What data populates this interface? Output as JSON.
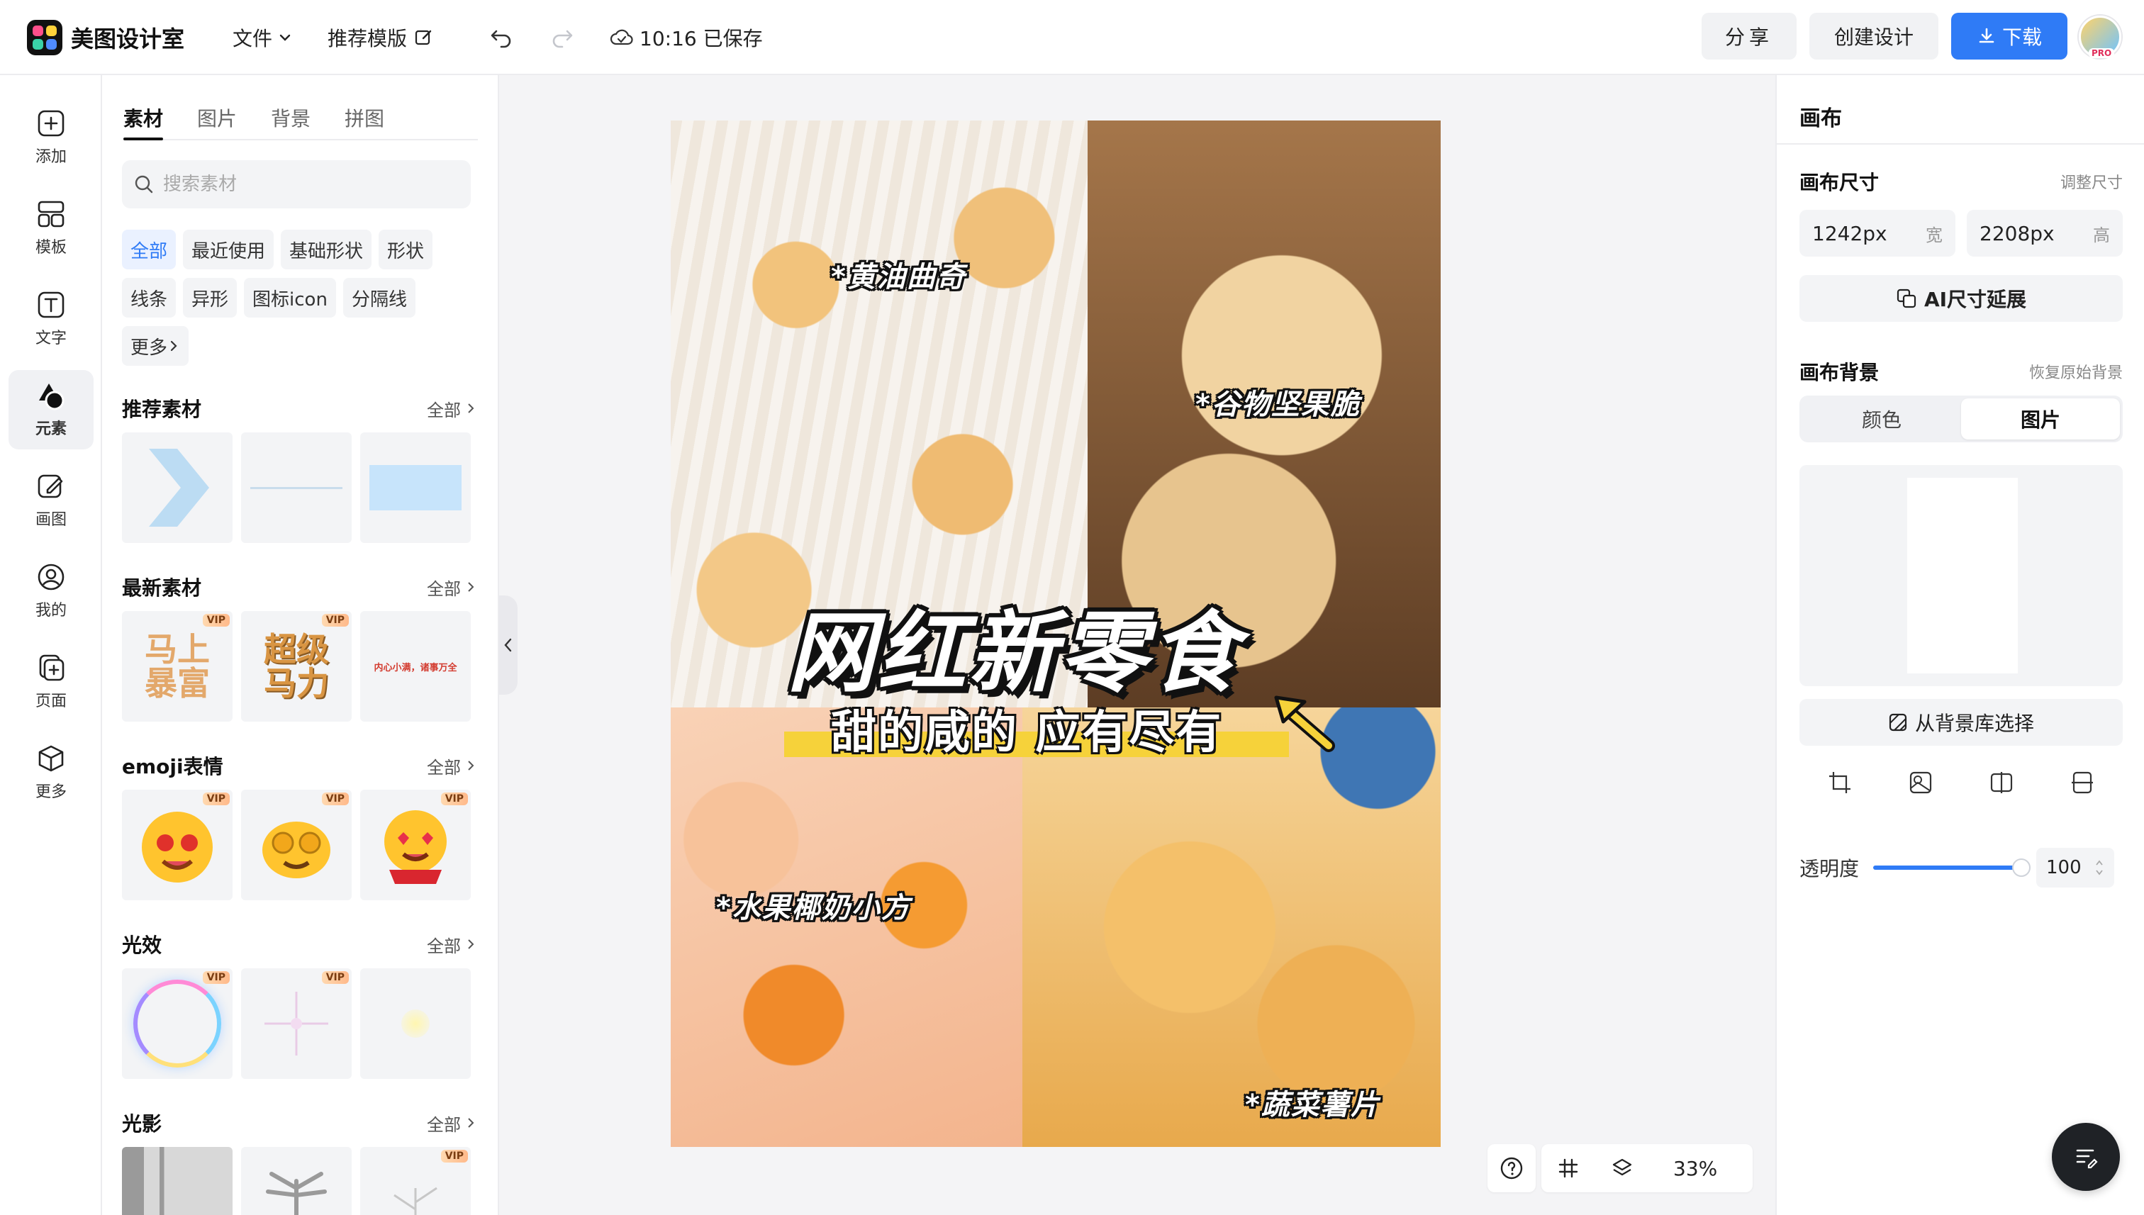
{
  "app": {
    "title": "美图设计室"
  },
  "toolbar": {
    "file_label": "文件",
    "template_label": "推荐模版",
    "save_status": "10:16 已保存",
    "share_label": "分享",
    "create_label": "创建设计",
    "download_label": "下载",
    "pro_badge": "PRO"
  },
  "rail": {
    "items": [
      {
        "label": "添加",
        "icon": "plus-square-icon"
      },
      {
        "label": "模板",
        "icon": "template-icon"
      },
      {
        "label": "文字",
        "icon": "text-icon"
      },
      {
        "label": "元素",
        "icon": "shapes-icon"
      },
      {
        "label": "画图",
        "icon": "draw-icon"
      },
      {
        "label": "我的",
        "icon": "user-icon"
      },
      {
        "label": "页面",
        "icon": "page-add-icon"
      },
      {
        "label": "更多",
        "icon": "cube-icon"
      }
    ]
  },
  "panel": {
    "tabs": [
      "素材",
      "图片",
      "背景",
      "拼图"
    ],
    "search_placeholder": "搜索素材",
    "chips": [
      "全部",
      "最近使用",
      "基础形状",
      "形状",
      "线条",
      "异形",
      "图标icon",
      "分隔线",
      "更多"
    ],
    "vip": "VIP",
    "all_label": "全部",
    "sections": [
      {
        "title": "推荐素材"
      },
      {
        "title": "最新素材",
        "thumb_texts": [
          "马上暴富",
          "超级马力",
          "内心小满，诸事万全"
        ]
      },
      {
        "title": "emoji表情"
      },
      {
        "title": "光效"
      },
      {
        "title": "光影"
      }
    ]
  },
  "canvas": {
    "labels": [
      "*黄油曲奇",
      "*谷物坚果脆",
      "*水果椰奶小方",
      "*蔬菜薯片"
    ],
    "title": "网红新零食",
    "subtitle": "甜的咸的 应有尽有"
  },
  "bottom": {
    "zoom": "33%"
  },
  "right": {
    "title": "画布",
    "size_label": "画布尺寸",
    "resize_link": "调整尺寸",
    "width_value": "1242px",
    "width_unit": "宽",
    "height_value": "2208px",
    "height_unit": "高",
    "ai_extend": "AI尺寸延展",
    "bg_label": "画布背景",
    "restore_link": "恢复原始背景",
    "seg_color": "颜色",
    "seg_image": "图片",
    "library_btn": "从背景库选择",
    "opacity_label": "透明度",
    "opacity_value": "100"
  },
  "colors": {
    "accent": "#2f7bf6",
    "title_yellow": "#f6d23a"
  }
}
